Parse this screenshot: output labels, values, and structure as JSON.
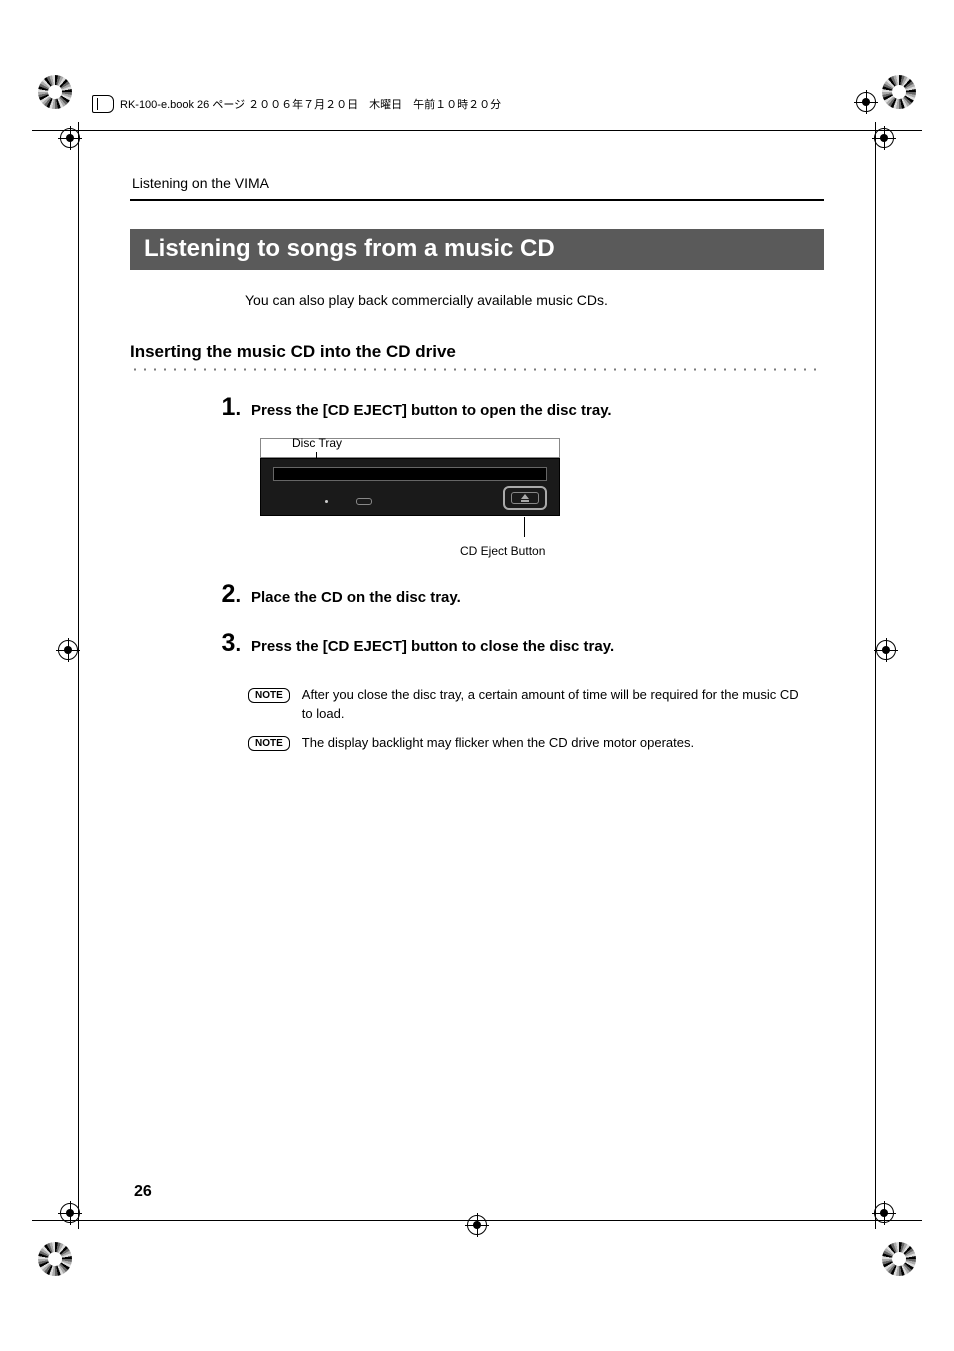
{
  "print_header": "RK-100-e.book 26 ページ ２００６年７月２０日　木曜日　午前１０時２０分",
  "running_head": "Listening on the VIMA",
  "section_title": "Listening to songs from a music CD",
  "intro_text": "You can also play back commercially available music CDs.",
  "subsection_title": "Inserting the music CD into the CD drive",
  "steps": [
    {
      "num": "1",
      "text": "Press the [CD EJECT] button to open the disc tray."
    },
    {
      "num": "2",
      "text": "Place the CD on the disc tray."
    },
    {
      "num": "3",
      "text": "Press the [CD EJECT] button to close the disc tray."
    }
  ],
  "diagram": {
    "disc_tray_label": "Disc Tray",
    "cd_eject_label": "CD Eject Button"
  },
  "notes": [
    {
      "badge": "NOTE",
      "text": "After you close the disc tray, a certain amount of time will be required for the music CD to load."
    },
    {
      "badge": "NOTE",
      "text": "The display backlight may flicker when the CD drive motor operates."
    }
  ],
  "page_number": "26"
}
